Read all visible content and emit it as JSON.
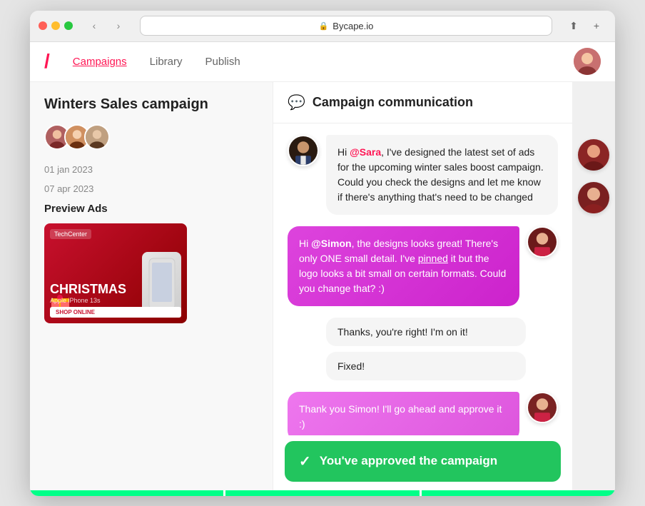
{
  "browser": {
    "url": "Bycape.io",
    "traffic_lights": [
      "close",
      "minimize",
      "maximize"
    ]
  },
  "nav": {
    "logo": "/",
    "links": [
      {
        "label": "Campaigns",
        "active": true
      },
      {
        "label": "Library",
        "active": false
      },
      {
        "label": "Publish",
        "active": false
      }
    ]
  },
  "left_panel": {
    "campaign_title": "Winters Sales campaign",
    "date1": "01 jan 2023",
    "date2": "07 apr 2023",
    "preview_ads_label": "Preview Ads",
    "ad": {
      "badge": "TechCenter",
      "title": "CHRISTMAS",
      "subtitle": "Apple iPhone 13s",
      "cta": "SHOP ONLINE"
    }
  },
  "chat": {
    "header_title": "Campaign communication",
    "messages": [
      {
        "sender": "simon",
        "side": "left",
        "text_parts": [
          {
            "type": "normal",
            "text": "Hi "
          },
          {
            "type": "mention",
            "text": "@Sara"
          },
          {
            "type": "normal",
            "text": ", I've designed the latest set of ads for the upcoming winter sales boost campaign. Could you check the designs and let me know if there's anything that's need to be changed"
          }
        ]
      },
      {
        "sender": "sara",
        "side": "right",
        "text_parts": [
          {
            "type": "normal",
            "text": "Hi "
          },
          {
            "type": "mention-right",
            "text": "@Simon"
          },
          {
            "type": "normal",
            "text": ", the designs looks great! There's only ONE small detail. I've "
          },
          {
            "type": "underline",
            "text": "pinned"
          },
          {
            "type": "normal",
            "text": " it but the logo looks a bit small on certain formats. Could you change that? :)"
          }
        ]
      },
      {
        "sender": "simon",
        "side": "left-small",
        "bubbles": [
          "Thanks, you're right!  I'm on it!",
          "Fixed!"
        ]
      },
      {
        "sender": "sara",
        "side": "right",
        "text_parts": [
          {
            "type": "normal",
            "text": "Thank you Simon!  I'll go ahead and approve it :)"
          }
        ]
      }
    ],
    "approval_text": "You've approved the campaign"
  }
}
